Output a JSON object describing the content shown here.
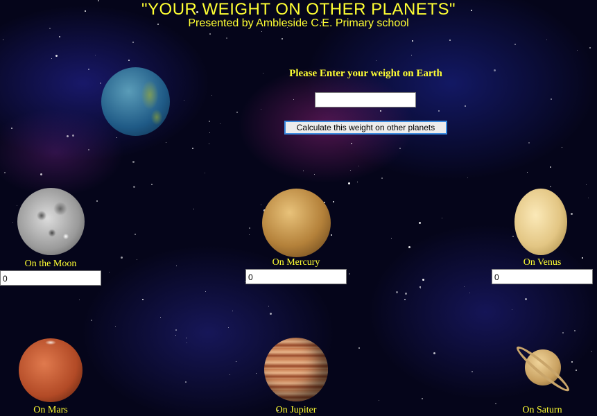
{
  "header": {
    "title": "\"YOUR WEIGHT ON OTHER PLANETS\"",
    "subtitle": "Presented by Ambleside C.E. Primary school"
  },
  "form": {
    "prompt": "Please Enter your weight on Earth",
    "weight_value": "",
    "calculate_label": "Calculate this weight on other planets"
  },
  "planets": [
    {
      "label": "On the Moon",
      "value": "0"
    },
    {
      "label": "On Mercury",
      "value": "0"
    },
    {
      "label": "On Venus",
      "value": "0"
    },
    {
      "label": "On Mars"
    },
    {
      "label": "On Jupiter"
    },
    {
      "label": "On Saturn"
    }
  ],
  "colors": {
    "heading": "#ffff33",
    "background": "#05051a",
    "button_border": "#3b8be0"
  },
  "icons": [
    "earth-image",
    "moon-image",
    "mercury-image",
    "venus-image",
    "mars-image",
    "jupiter-image",
    "saturn-image"
  ]
}
